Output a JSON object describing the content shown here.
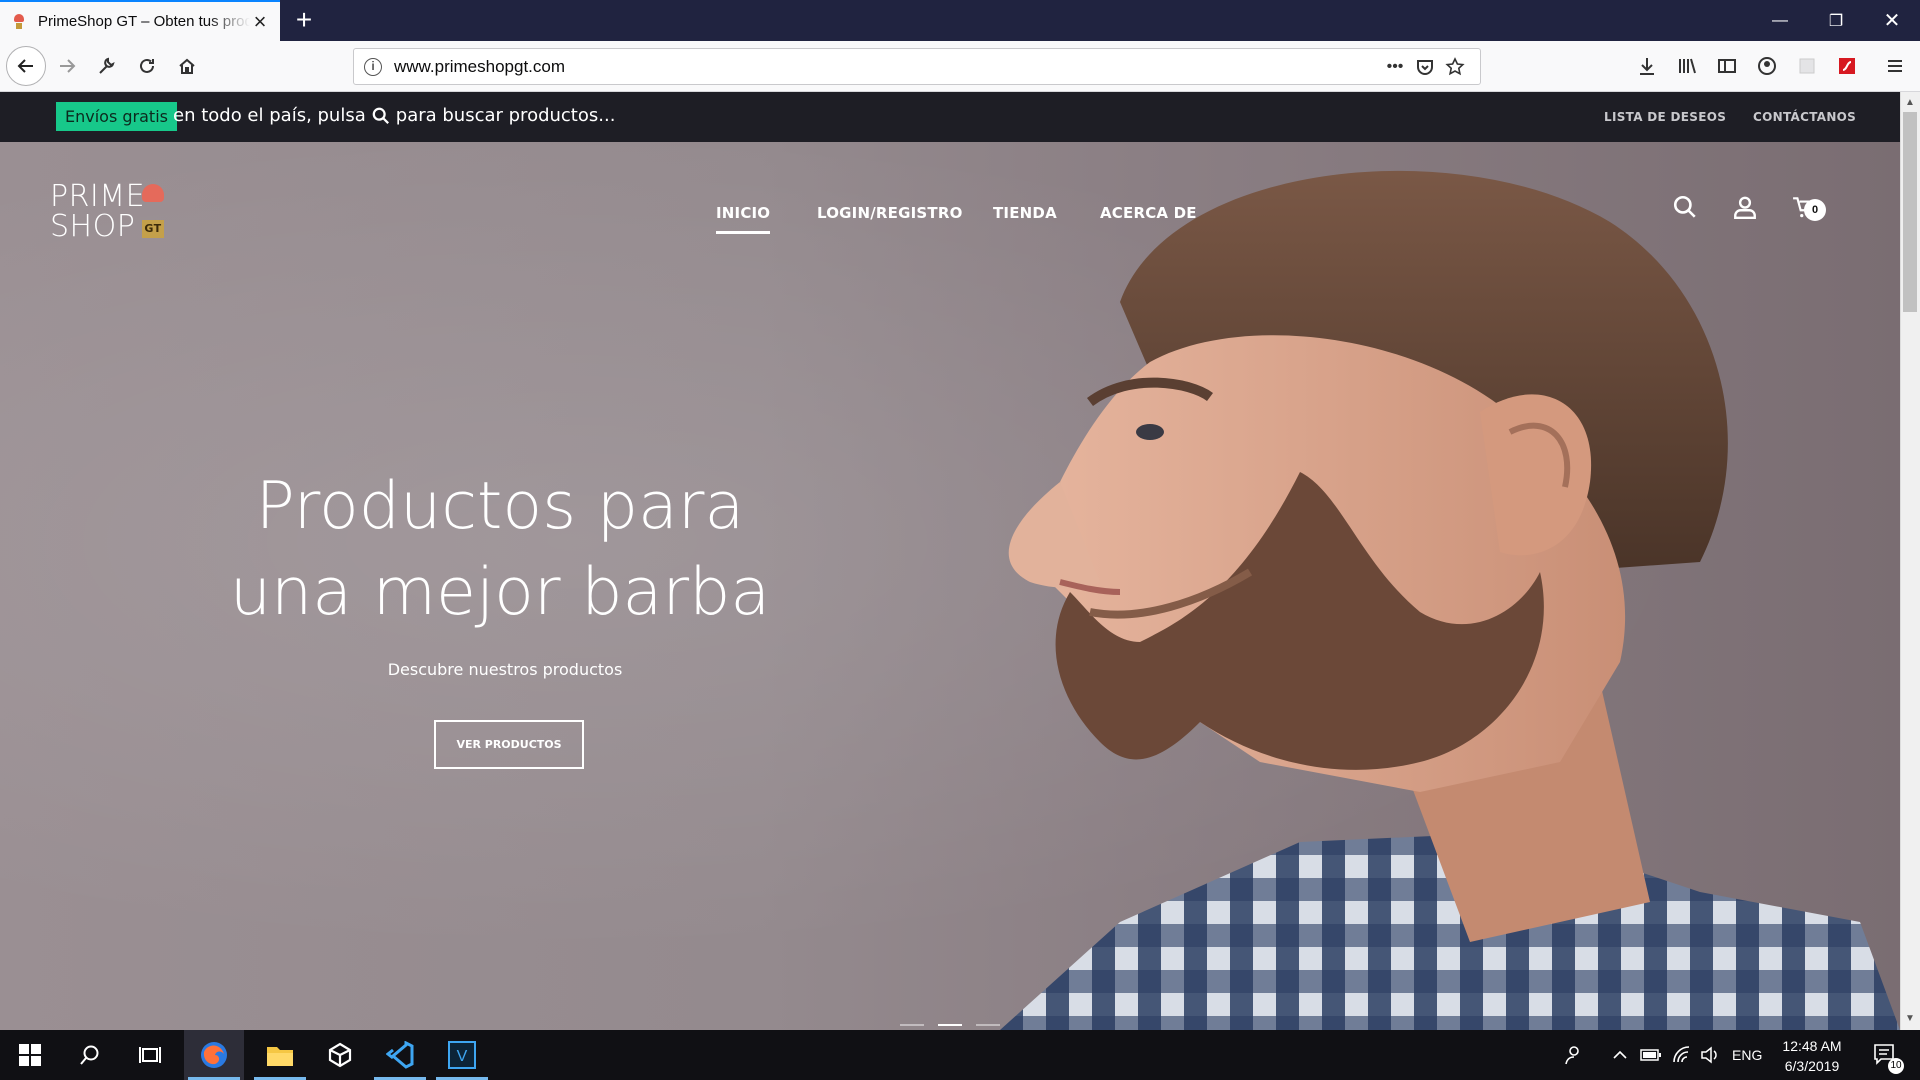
{
  "browser": {
    "tab_title": "PrimeShop GT – Obten tus productos",
    "url": "www.primeshopgt.com"
  },
  "site": {
    "promo_badge": "Envíos gratis",
    "promo_text_before": "en todo el país, pulsa",
    "promo_text_after": "para buscar productos...",
    "top_links": [
      "LISTA DE DESEOS",
      "CONTÁCTANOS"
    ],
    "logo_line1": "PRIME",
    "logo_line2": "SHOP",
    "logo_badge": "GT",
    "nav": [
      "INICIO",
      "LOGIN/REGISTRO",
      "TIENDA",
      "ACERCA DE"
    ],
    "cart_count": "0",
    "hero": {
      "title_line1": "Productos para",
      "title_line2": "una mejor barba",
      "subtitle": "Descubre nuestros productos",
      "button": "VER PRODUCTOS",
      "slides": 3,
      "active_slide": 2
    },
    "colors": {
      "accent": "#17c88a",
      "topbar": "#1e1e25"
    }
  },
  "taskbar": {
    "time": "12:48 AM",
    "date": "6/3/2019",
    "language": "ENG",
    "notifications": "10"
  }
}
